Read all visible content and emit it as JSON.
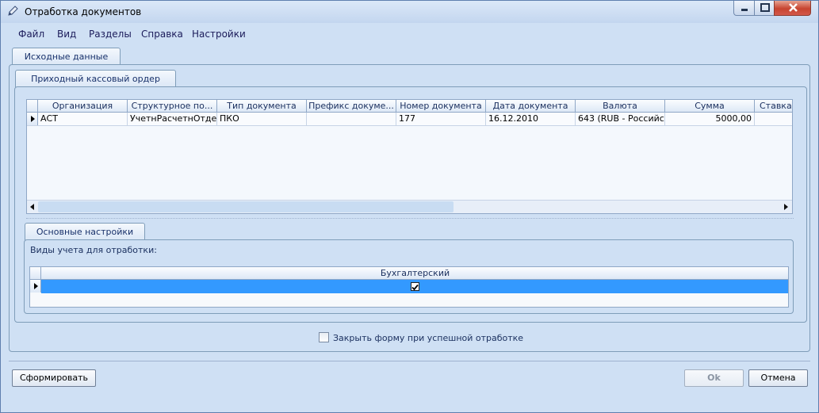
{
  "window": {
    "title": "Отработка документов",
    "title_icon": "pencil-app-icon"
  },
  "menu": [
    "Файл",
    "Вид",
    "Разделы",
    "Справка",
    "Настройки"
  ],
  "tabs": {
    "outer": "Исходные данные",
    "inner": "Приходный кассовый ордер",
    "settings": "Основные настройки"
  },
  "documents_grid": {
    "columns": [
      "Организация",
      "Структурное по...",
      "Тип документа",
      "Префикс докуме...",
      "Номер документа",
      "Дата документа",
      "Валюта",
      "Сумма",
      "Ставка"
    ],
    "rows": [
      [
        "АСТ",
        "УчетнРасчетнОтдел",
        "ПКО",
        "",
        "177",
        "16.12.2010",
        "643 (RUB - Российс...",
        "5000,00",
        ""
      ]
    ]
  },
  "settings": {
    "label": "Виды учета для отработки:",
    "grid_column": "Бухгалтерский",
    "grid_checked": true
  },
  "close_on_success": {
    "label": "Закрыть форму при успешной отработке",
    "checked": false
  },
  "buttons": {
    "generate": "Сформировать",
    "ok": "Ok",
    "cancel": "Отмена"
  }
}
